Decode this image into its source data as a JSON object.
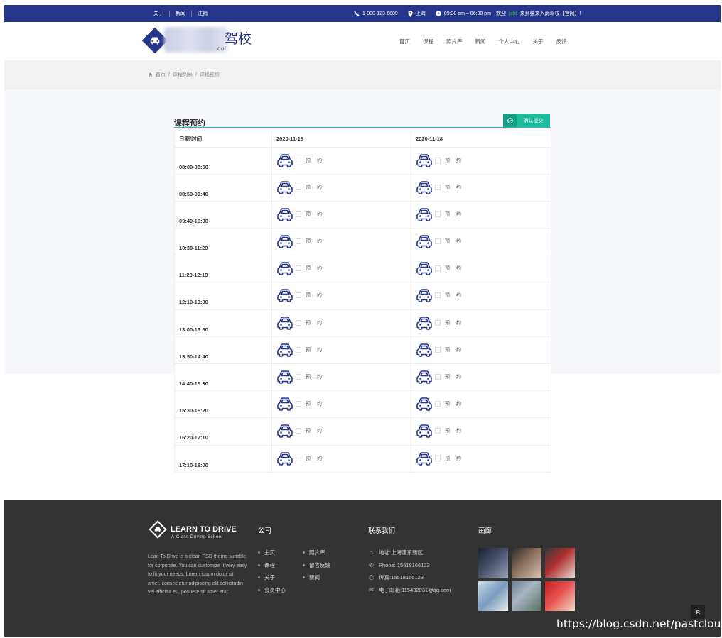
{
  "topbar": {
    "links": [
      "关于",
      "新闻",
      "注销"
    ],
    "phone": "1-800-123-6889",
    "location": "上海",
    "hours": "09:30 am – 06:00 pm",
    "welcome_prefix": "欢迎",
    "welcome_user": "pdd",
    "welcome_suffix": "来到猿来入此驾校【官网】!"
  },
  "header": {
    "logo_text": "驾校",
    "logo_sub": "ool",
    "nav": [
      "首页",
      "课程",
      "照片库",
      "新闻",
      "个人中心",
      "关于",
      "反馈"
    ]
  },
  "breadcrumb": [
    "首页",
    "课程列表",
    "课程预约"
  ],
  "booking": {
    "title": "课程预约",
    "submit_label": "确认提交",
    "header_time": "日期/时间",
    "dates": [
      "2020-11-18",
      "2020-11-18"
    ],
    "slot_label": "预约",
    "times": [
      "08:00-08:50",
      "08:50-09:40",
      "09:40-10:30",
      "10:30-11:20",
      "11:20-12:10",
      "12:10-13:00",
      "13:00-13:50",
      "13:50-14:40",
      "14:40-15:30",
      "15:30-16:20",
      "16:20-17:10",
      "17:10-18:00"
    ]
  },
  "footer": {
    "brand": "LEARN TO DRIVE",
    "brand_sub": "A-Class Driving School",
    "about": "Lean To Drive is a clean PSD theme suitable for corporate. You can customize it very easy to fit your needs. Lorem ipsum dolor sit amet, consectetur adipiscing elit sollicitudin vel efficitur eu, posuere sit amet erat.",
    "company_title": "公司",
    "company_col1": [
      "主页",
      "课程",
      "关于",
      "会员中心"
    ],
    "company_col2": [
      "照片库",
      "留言反馈",
      "新闻"
    ],
    "contact_title": "联系我们",
    "contact": {
      "address": "地址:上海浦东新区",
      "phone": "Phone: 15518166123",
      "fax": "传真:15518166123",
      "email": "电子邮箱:115432031@qq.com"
    },
    "gallery_title": "画廊",
    "watermark": "https://blog.csdn.net/pastclouds"
  },
  "colors": {
    "primary": "#26378b",
    "accent": "#1abc9c",
    "footer_bg": "#333333"
  }
}
